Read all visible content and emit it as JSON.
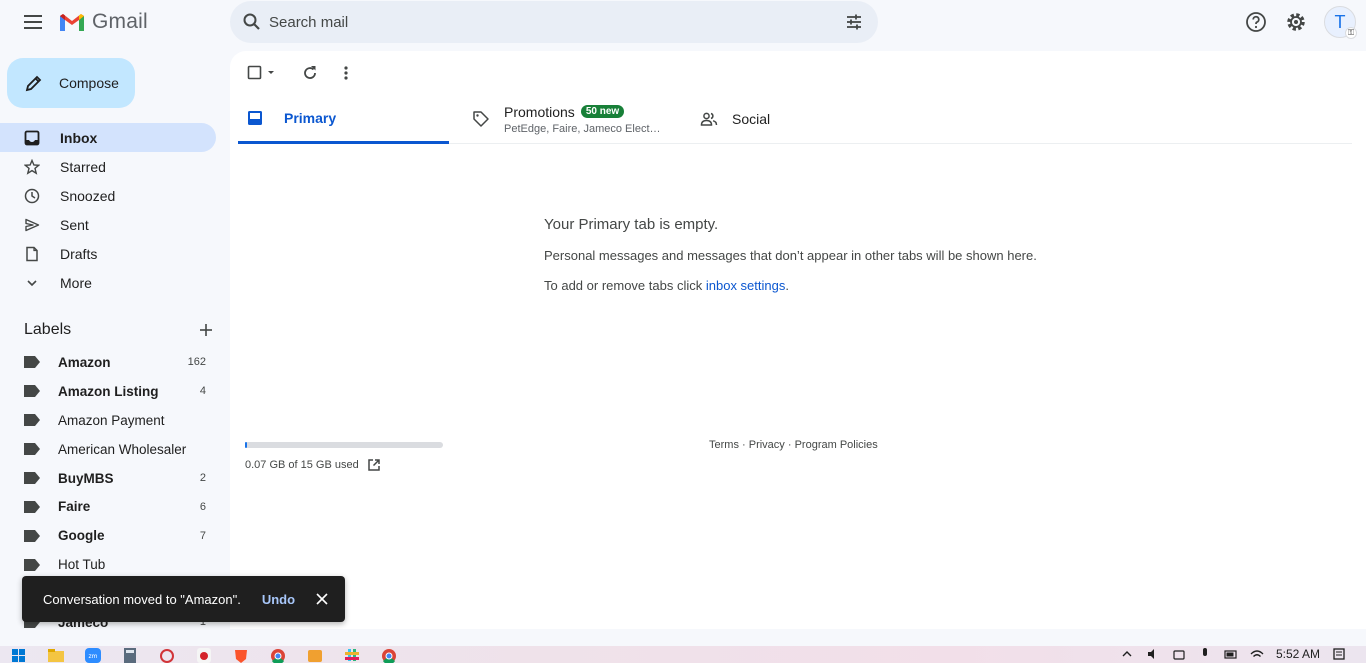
{
  "app": {
    "name": "Gmail"
  },
  "search": {
    "placeholder": "Search mail"
  },
  "header": {
    "avatar_letter": "T"
  },
  "compose": {
    "label": "Compose"
  },
  "nav": [
    {
      "label": "Inbox",
      "icon": "inbox-icon",
      "active": true
    },
    {
      "label": "Starred",
      "icon": "star-icon"
    },
    {
      "label": "Snoozed",
      "icon": "clock-icon"
    },
    {
      "label": "Sent",
      "icon": "send-icon"
    },
    {
      "label": "Drafts",
      "icon": "draft-icon"
    },
    {
      "label": "More",
      "icon": "chevron-down-icon"
    }
  ],
  "labels": {
    "title": "Labels",
    "items": [
      {
        "name": "Amazon",
        "count": "162",
        "bold": true
      },
      {
        "name": "Amazon Listing",
        "count": "4",
        "bold": true
      },
      {
        "name": "Amazon Payment",
        "count": "",
        "bold": false
      },
      {
        "name": "American Wholesaler",
        "count": "",
        "bold": false
      },
      {
        "name": "BuyMBS",
        "count": "2",
        "bold": true
      },
      {
        "name": "Faire",
        "count": "6",
        "bold": true
      },
      {
        "name": "Google",
        "count": "7",
        "bold": true
      },
      {
        "name": "Hot Tub",
        "count": "",
        "bold": false
      },
      {
        "name": "",
        "count": "",
        "bold": false
      },
      {
        "name": "Jameco",
        "count": "1",
        "bold": true
      }
    ]
  },
  "tabs": {
    "primary": "Primary",
    "promotions": "Promotions",
    "promotions_badge": "50 new",
    "promotions_senders": "PetEdge, Faire, Jameco Electro...",
    "social": "Social"
  },
  "empty": {
    "title": "Your Primary tab is empty.",
    "line1": "Personal messages and messages that don’t appear in other tabs will be shown here.",
    "line2_prefix": "To add or remove tabs click ",
    "line2_link": "inbox settings",
    "line2_suffix": "."
  },
  "storage": {
    "text": "0.07 GB of 15 GB used",
    "used_fraction": 0.005
  },
  "footer": {
    "terms": "Terms",
    "privacy": "Privacy",
    "policies": "Program Policies",
    "sep": " · "
  },
  "snackbar": {
    "message": "Conversation moved to \"Amazon\".",
    "undo": "Undo"
  },
  "taskbar": {
    "time": "5:52 AM"
  },
  "colors": {
    "accent": "#0b57d0",
    "compose_bg": "#c2e7ff",
    "active_nav": "#d3e3fd",
    "badge": "#188038"
  }
}
